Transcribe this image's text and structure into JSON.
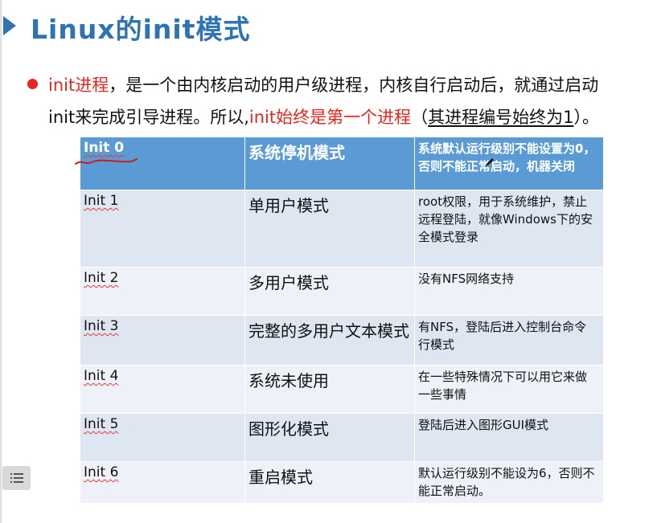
{
  "title": "Linux的init模式",
  "bullet": {
    "line1_part1": "init进程",
    "line1_part2": "，是一个由内核启动的用户级进程，内核自行启动后，就通过启动",
    "line2_part1": "init来完成引导进程。所以,",
    "line2_part2": "init始终是第一个进程",
    "line2_part3": "（",
    "line2_part4": "其进程编号始终为1",
    "line2_part5": "）。"
  },
  "table": {
    "header": {
      "level": "Init 0",
      "mode": "系统停机模式",
      "desc": "系统默认运行级别不能设置为0，否则不能正常启动，机器关闭"
    },
    "rows": [
      {
        "level": "Init 1",
        "mode": "单用户模式",
        "desc": "root权限，用于系统维护，禁止远程登陆，就像Windows下的安全模式登录"
      },
      {
        "level": "Init 2",
        "mode": "多用户模式",
        "desc": "没有NFS网络支持"
      },
      {
        "level": "Init 3",
        "mode": "完整的多用户文本模式",
        "desc": "有NFS，登陆后进入控制台命令行模式"
      },
      {
        "level": "Init 4",
        "mode": "系统未使用",
        "desc": "在一些特殊情况下可以用它来做一些事情"
      },
      {
        "level": "Init 5",
        "mode": "图形化模式",
        "desc": "登陆后进入图形GUI模式"
      },
      {
        "level": "Init 6",
        "mode": "重启模式",
        "desc": "默认运行级别不能设为6，否则不能正常启动。"
      }
    ]
  },
  "colors": {
    "title": "#2e74b5",
    "accent_red": "#e8261c",
    "table_header": "#5b9bd5",
    "row_a": "#dde6f1",
    "row_b": "#eef2f8"
  },
  "icons": {
    "title_marker": "triangle-right-icon",
    "bullet": "bullet-dot-icon",
    "annotation": "pen-icon",
    "menu": "list-menu-icon"
  }
}
